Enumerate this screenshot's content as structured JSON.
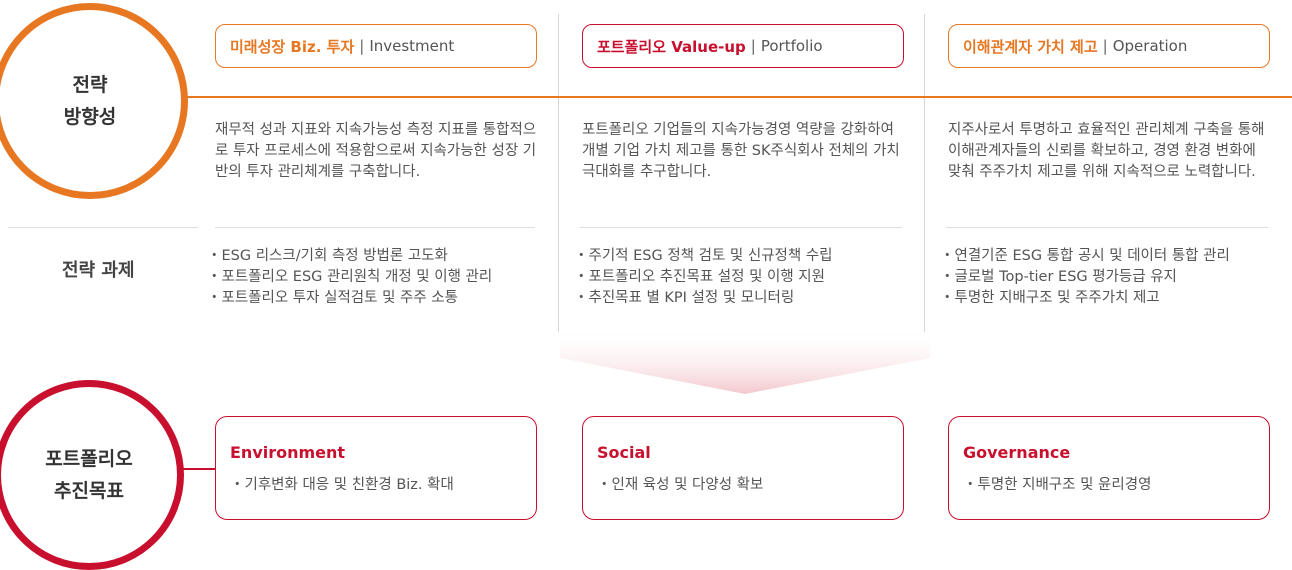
{
  "colors": {
    "orange": "#e87722",
    "crimson": "#c8102e",
    "text": "#555555",
    "divider": "#dedede"
  },
  "strategy_circle": {
    "label": "전략\n방향성"
  },
  "portfolio_circle": {
    "label": "포트폴리오\n추진목표"
  },
  "tasks_label": "전략 과제",
  "columns": [
    {
      "header_main": "미래성장 Biz. 투자",
      "header_sep": "|",
      "header_eng": "Investment",
      "description": "재무적 성과 지표와 지속가능성 측정 지표를 통합적으로 투자 프로세스에 적용함으로써 지속가능한 성장 기반의 투자 관리체계를 구축합니다.",
      "tasks": [
        "ESG 리스크/기회 측정 방법론 고도화",
        "포트폴리오 ESG 관리원칙 개정 및 이행 관리",
        "포트폴리오 투자 실적검토 및 주주 소통"
      ]
    },
    {
      "header_main": "포트폴리오 Value-up",
      "header_sep": "|",
      "header_eng": "Portfolio",
      "description": "포트폴리오 기업들의 지속가능경영 역량을 강화하여 개별 기업 가치 제고를 통한 SK주식회사 전체의 가치 극대화를 추구합니다.",
      "tasks": [
        "주기적 ESG 정책 검토 및 신규정책 수립",
        "포트폴리오 추진목표 설정 및 이행 지원",
        "추진목표 별 KPI 설정 및 모니터링"
      ]
    },
    {
      "header_main": "이해관계자 가치 제고",
      "header_sep": "|",
      "header_eng": "Operation",
      "description": "지주사로서 투명하고 효율적인 관리체계 구축을 통해 이해관계자들의 신뢰를 확보하고, 경영 환경 변화에 맞춰 주주가치 제고를 위해 지속적으로 노력합니다.",
      "tasks": [
        "연결기준 ESG 통합 공시 및 데이터 통합 관리",
        "글로벌 Top-tier ESG 평가등급 유지",
        "투명한 지배구조 및 주주가치 제고"
      ]
    }
  ],
  "goals": [
    {
      "title": "Environment",
      "item": "기후변화 대응 및 친환경 Biz. 확대"
    },
    {
      "title": "Social",
      "item": "인재 육성 및 다양성 확보"
    },
    {
      "title": "Governance",
      "item": "투명한 지배구조 및 윤리경영"
    }
  ]
}
